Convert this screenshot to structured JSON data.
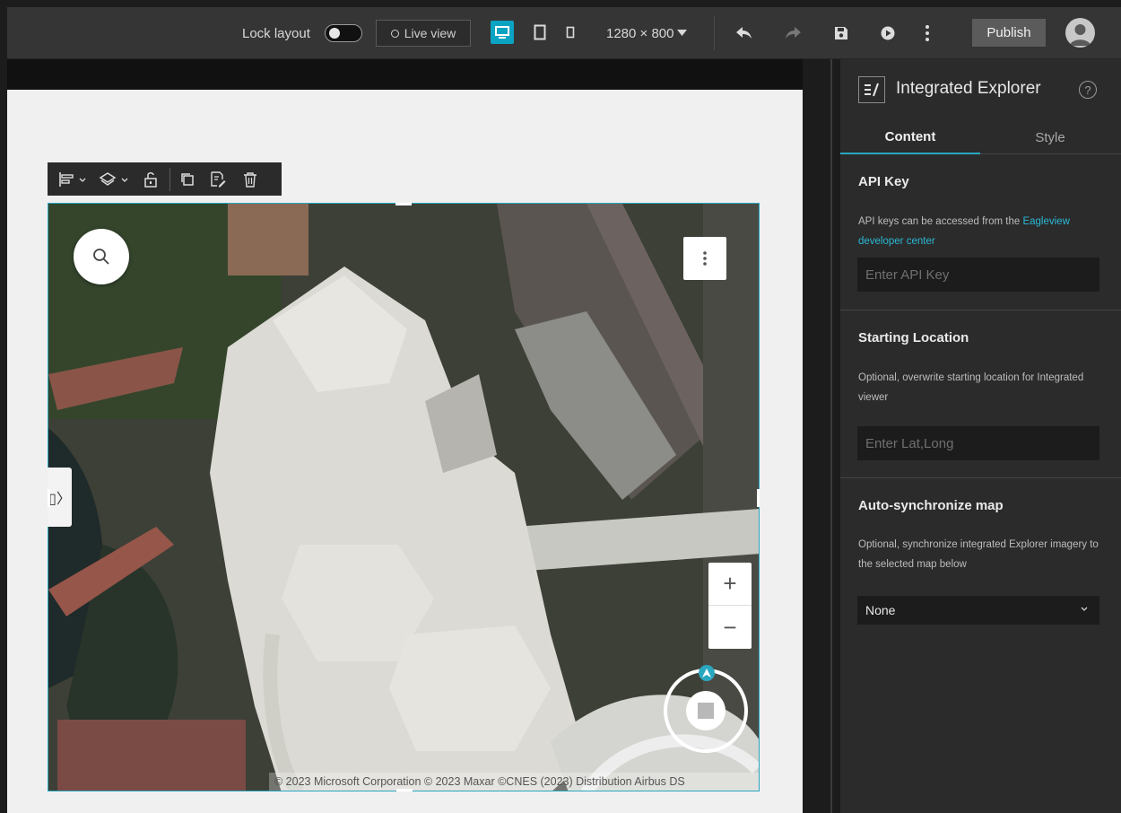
{
  "toolbar": {
    "lock_layout_label": "Lock layout",
    "live_view_label": "Live view",
    "resolution_label": "1280 × 800",
    "publish_label": "Publish",
    "accent_color": "#0aa3c2"
  },
  "map": {
    "attribution": "© 2023 Microsoft Corporation © 2023 Maxar ©CNES (2023) Distribution Airbus DS",
    "zoom_in": "+",
    "zoom_out": "−",
    "side_tab": "▯〉"
  },
  "panel": {
    "title": "Integrated Explorer",
    "tabs": [
      "Content",
      "Style"
    ],
    "api_key": {
      "title": "API Key",
      "desc_prefix": "API keys can be accessed from the ",
      "desc_link": "Eagleview developer center",
      "placeholder": "Enter API Key"
    },
    "starting_location": {
      "title": "Starting Location",
      "desc": "Optional, overwrite starting location for Integrated viewer",
      "placeholder": "Enter Lat,Long"
    },
    "auto_sync": {
      "title": "Auto-synchronize map",
      "desc": "Optional, synchronize integrated Explorer imagery to the selected map below",
      "selected": "None"
    }
  }
}
